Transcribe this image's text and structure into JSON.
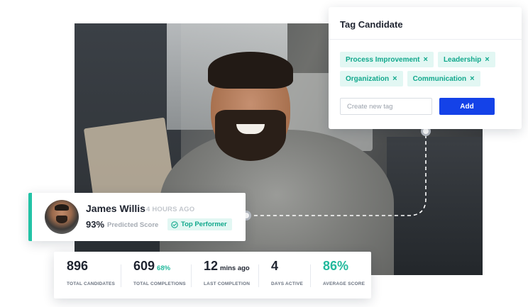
{
  "tag_card": {
    "title": "Tag Candidate",
    "tags": [
      {
        "label": "Process Improvement",
        "remove": "×"
      },
      {
        "label": "Leadership",
        "remove": "×"
      },
      {
        "label": "Organization",
        "remove": "×"
      },
      {
        "label": "Communication",
        "remove": "×"
      }
    ],
    "input_placeholder": "Create new tag",
    "add_label": "Add"
  },
  "candidate": {
    "name": "James Willis",
    "time_ago": "4 HOURS AGO",
    "score": "93%",
    "score_label": "Predicted Score",
    "badge": "Top Performer",
    "badge_icon": "check-circle-icon"
  },
  "stats": [
    {
      "value": "896",
      "suffix": "",
      "label": "TOTAL CANDIDATES"
    },
    {
      "value": "609",
      "suffix": "68%",
      "label": "TOTAL COMPLETIONS"
    },
    {
      "value": "12",
      "suffix": "mins ago",
      "label": "LAST COMPLETION"
    },
    {
      "value": "4",
      "suffix": "",
      "label": "DAYS ACTIVE"
    },
    {
      "value": "86%",
      "suffix": "",
      "label": "AVERAGE SCORE"
    }
  ],
  "colors": {
    "accent_teal": "#22c3a6",
    "tag_bg": "#e2f7f3",
    "button_blue": "#1442e8"
  }
}
